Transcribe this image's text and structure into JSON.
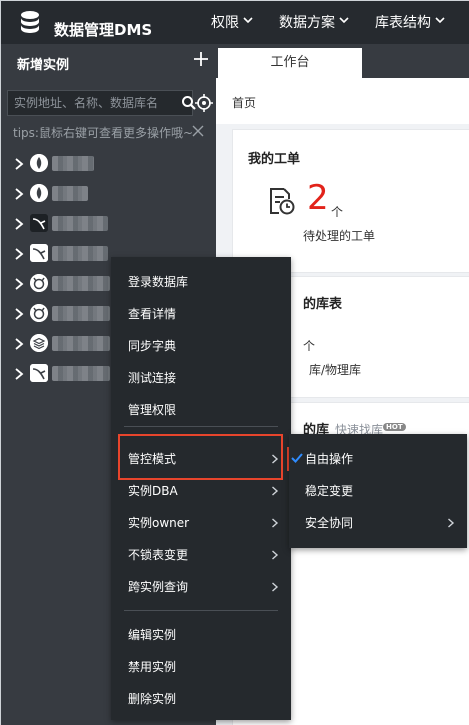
{
  "header": {
    "app_title": "数据管理DMS",
    "nav": [
      "权限",
      "数据方案",
      "库表结构"
    ]
  },
  "sidebar": {
    "title": "新增实例",
    "search_placeholder": "实例地址、名称、数据库名",
    "tips": "tips:鼠标右键可查看更多操作哦~",
    "instances": [
      {
        "icon": "mongodb-icon"
      },
      {
        "icon": "mongodb-icon"
      },
      {
        "icon": "mysql-icon"
      },
      {
        "icon": "mysql-icon"
      },
      {
        "icon": "redis-icon"
      },
      {
        "icon": "redis-icon"
      },
      {
        "icon": "database-stack-icon"
      },
      {
        "icon": "mysql-icon"
      }
    ]
  },
  "main": {
    "tab": "工作台",
    "breadcrumb": "首页",
    "work_orders": {
      "title": "我的工单",
      "count": "2",
      "unit": "个",
      "label": "待处理的工单"
    },
    "tables_card": {
      "title_partial": "的库表",
      "unit": "个",
      "label_partial": "库/物理库"
    },
    "db_card": {
      "title_partial": "的库",
      "quick_link": "快速找库",
      "badge": "HOT"
    }
  },
  "context_menu": {
    "items": [
      "登录数据库",
      "查看详情",
      "同步字典",
      "测试连接",
      "管理权限"
    ],
    "submenu_items": [
      "管控模式",
      "实例DBA",
      "实例owner",
      "不锁表变更",
      "跨实例查询"
    ],
    "tail_items": [
      "编辑实例",
      "禁用实例",
      "删除实例"
    ]
  },
  "control_mode_submenu": {
    "items": [
      "自由操作",
      "稳定变更",
      "安全协同"
    ],
    "checked": "自由操作"
  },
  "colors": {
    "topbar": "#262a2f",
    "sidebar": "#373b41",
    "menu": "#25292d",
    "highlight": "#e8452c",
    "count": "#e2231a"
  }
}
